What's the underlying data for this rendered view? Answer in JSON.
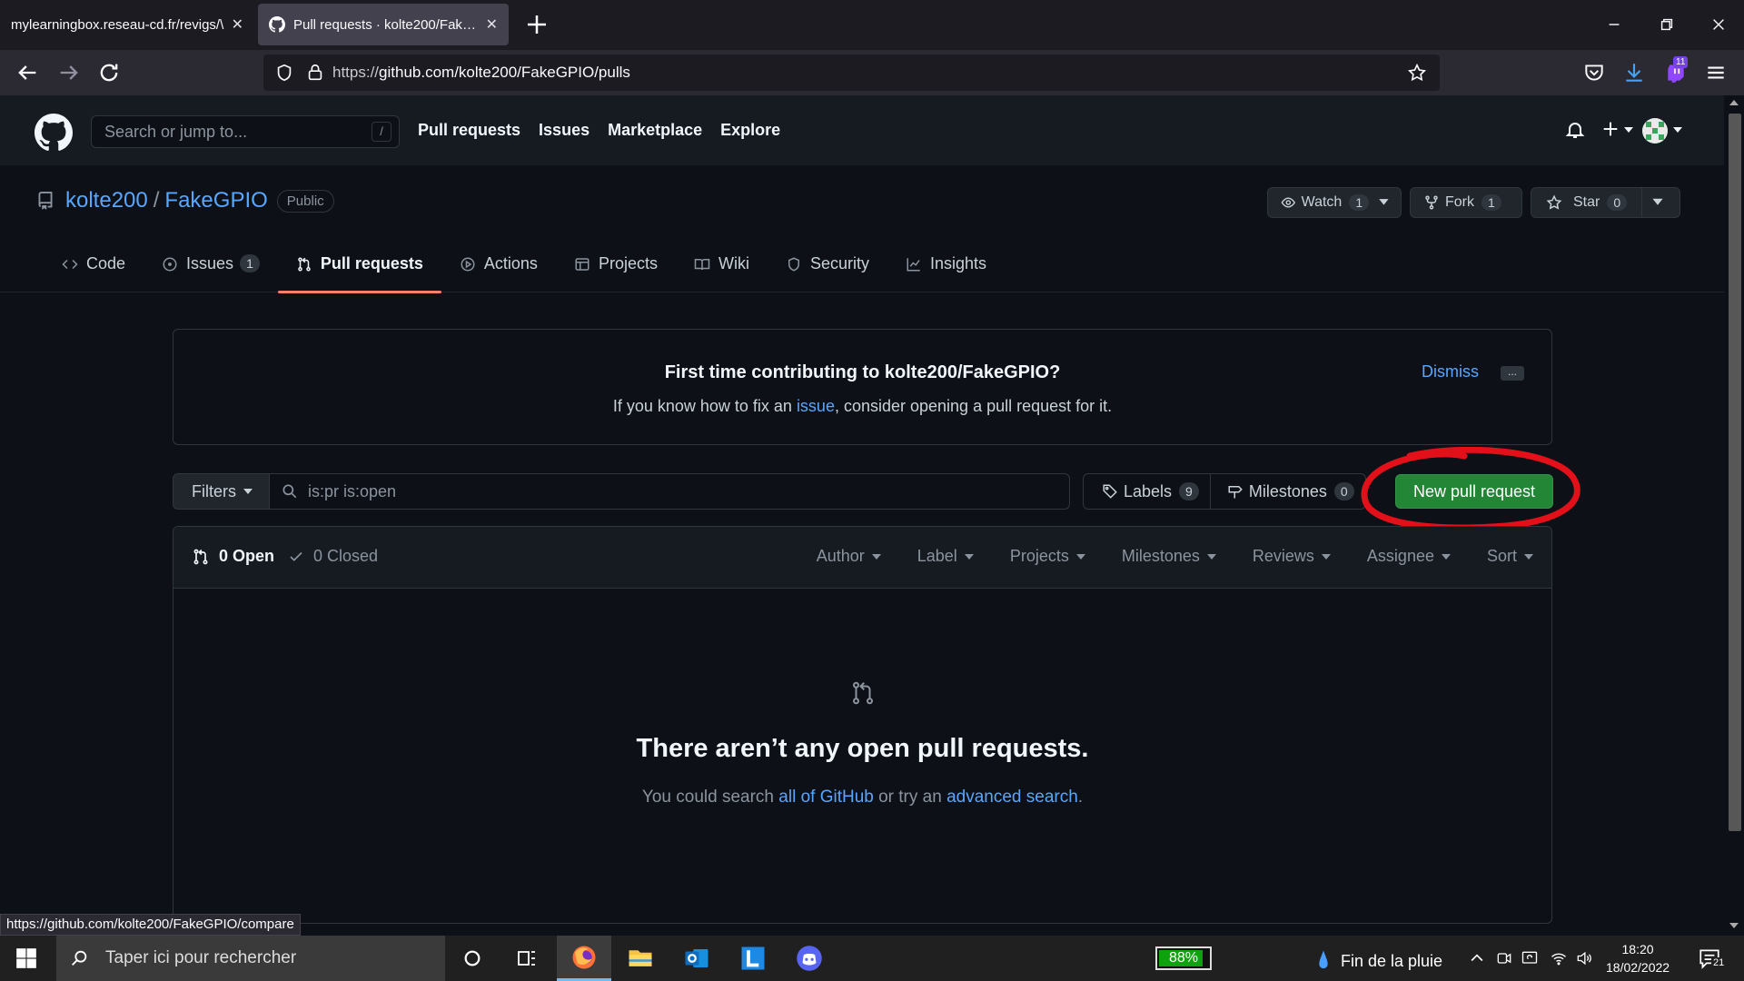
{
  "browser": {
    "tabs": [
      {
        "title": "mylearningbox.reseau-cd.fr/revigs/\\",
        "active": false
      },
      {
        "title": "Pull requests · kolte200/FakeGPIO",
        "active": true
      }
    ],
    "url_prefix": "https://",
    "url_main": "github.com/kolte200/FakeGPIO/pulls",
    "extension_badge": "11"
  },
  "github": {
    "search_placeholder": "Search or jump to...",
    "search_key": "/",
    "nav": [
      "Pull requests",
      "Issues",
      "Marketplace",
      "Explore"
    ]
  },
  "repo": {
    "owner": "kolte200",
    "separator": "/",
    "name": "FakeGPIO",
    "visibility": "Public",
    "watch": {
      "label": "Watch",
      "count": "1"
    },
    "fork": {
      "label": "Fork",
      "count": "1"
    },
    "star": {
      "label": "Star",
      "count": "0"
    },
    "tabs": [
      {
        "label": "Code",
        "icon": "code-icon"
      },
      {
        "label": "Issues",
        "icon": "issue-icon",
        "count": "1"
      },
      {
        "label": "Pull requests",
        "icon": "pull-request-icon",
        "active": true
      },
      {
        "label": "Actions",
        "icon": "play-icon"
      },
      {
        "label": "Projects",
        "icon": "table-icon"
      },
      {
        "label": "Wiki",
        "icon": "book-icon"
      },
      {
        "label": "Security",
        "icon": "shield-icon"
      },
      {
        "label": "Insights",
        "icon": "graph-icon"
      }
    ]
  },
  "banner": {
    "title": "First time contributing to kolte200/FakeGPIO?",
    "text_before": "If you know how to fix an ",
    "link": "issue",
    "text_after": ", consider opening a pull request for it.",
    "dismiss": "Dismiss",
    "more": "..."
  },
  "filters": {
    "button": "Filters",
    "query": "is:pr is:open",
    "labels": {
      "label": "Labels",
      "count": "9"
    },
    "milestones": {
      "label": "Milestones",
      "count": "0"
    },
    "new_pr": "New pull request"
  },
  "list": {
    "open": "0 Open",
    "closed": "0 Closed",
    "menus": [
      "Author",
      "Label",
      "Projects",
      "Milestones",
      "Reviews",
      "Assignee",
      "Sort"
    ],
    "empty_title": "There aren’t any open pull requests.",
    "empty_before": "You could search ",
    "empty_link1": "all of GitHub",
    "empty_middle": " or try an ",
    "empty_link2": "advanced search",
    "empty_after": "."
  },
  "status_url": "https://github.com/kolte200/FakeGPIO/compare",
  "taskbar": {
    "search_placeholder": "Taper ici pour rechercher",
    "battery": "88%",
    "battery_level": 0.88,
    "weather": "Fin de la pluie",
    "time": "18:20",
    "date": "18/02/2022",
    "notifications": "21"
  },
  "colors": {
    "accent": "#58a6ff",
    "primary_button": "#238636",
    "active_tab_underline": "#f78166",
    "annotation": "#e3101a"
  }
}
